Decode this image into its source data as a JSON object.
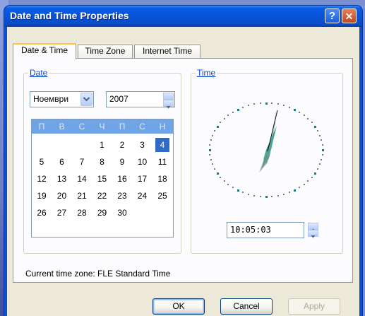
{
  "window": {
    "title": "Date and Time Properties",
    "help_glyph": "?",
    "close_glyph": "✕"
  },
  "tabs": [
    {
      "label": "Date & Time",
      "active": true
    },
    {
      "label": "Time Zone",
      "active": false
    },
    {
      "label": "Internet Time",
      "active": false
    }
  ],
  "date_group": {
    "label": "Date",
    "month": "Ноември",
    "year": "2007",
    "weekday_headers": [
      "П",
      "В",
      "С",
      "Ч",
      "П",
      "С",
      "Н"
    ],
    "weeks": [
      [
        "",
        "",
        "",
        "1",
        "2",
        "3",
        "4"
      ],
      [
        "5",
        "6",
        "7",
        "8",
        "9",
        "10",
        "11"
      ],
      [
        "12",
        "13",
        "14",
        "15",
        "16",
        "17",
        "18"
      ],
      [
        "19",
        "20",
        "21",
        "22",
        "23",
        "24",
        "25"
      ],
      [
        "26",
        "27",
        "28",
        "29",
        "30",
        "",
        ""
      ]
    ],
    "selected_day": "4"
  },
  "time_group": {
    "label": "Time",
    "time_value": "10:05:03"
  },
  "status": {
    "timezone_text": "Current time zone:  FLE Standard Time"
  },
  "buttons": {
    "ok": "OK",
    "cancel": "Cancel",
    "apply": "Apply"
  },
  "colors": {
    "titlebar": "#0a54d8",
    "selection": "#316ac5",
    "calendar_header": "#6fa5e6",
    "clock_hands": "#2a9a90"
  }
}
